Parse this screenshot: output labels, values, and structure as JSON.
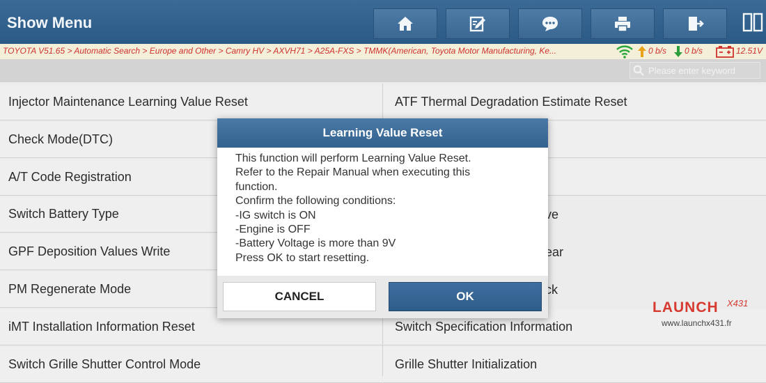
{
  "header": {
    "title": "Show Menu",
    "buttons": [
      {
        "icon": "home-icon"
      },
      {
        "icon": "edit-icon"
      },
      {
        "icon": "chat-icon"
      },
      {
        "icon": "print-icon"
      },
      {
        "icon": "exit-icon"
      }
    ],
    "split_icon": "split-view-icon",
    "color": "#2f5e8b"
  },
  "breadcrumb": {
    "path": "TOYOTA V51.65 > Automatic Search > Europe and Other > Camry HV > AXVH71 > A25A-FXS > TMMK(American, Toyota Motor Manufacturing, Ke...",
    "upload": "0 b/s",
    "download": "0 b/s",
    "voltage": "12.51V",
    "text_color": "#d0312d"
  },
  "search": {
    "placeholder": "Please enter keyword"
  },
  "menu": {
    "left": [
      "Injector Maintenance Learning Value Reset",
      "Check Mode(DTC)",
      "A/T Code Registration",
      "Switch Battery Type",
      "GPF Deposition Values Write",
      "PM Regenerate Mode",
      "iMT Installation Information Reset",
      "Switch Grille Shutter Control Mode"
    ],
    "right": [
      "ATF Thermal Degradation Estimate Reset",
      "",
      "",
      "ve",
      "ear",
      "ck",
      "Switch Specification Information",
      "Grille Shutter Initialization"
    ]
  },
  "dialog": {
    "title": "Learning Value Reset",
    "lines": [
      "This function will perform Learning Value Reset.",
      "Refer to the Repair Manual when executing this",
      "function.",
      "Confirm the following conditions:",
      "-IG switch is ON",
      "-Engine is OFF",
      "-Battery Voltage is more than 9V",
      "Press OK to start resetting."
    ],
    "cancel_label": "CANCEL",
    "ok_label": "OK"
  },
  "watermark": {
    "logo": "LAUNCH",
    "logo_suffix": "X431",
    "url": "www.launchx431.fr"
  }
}
